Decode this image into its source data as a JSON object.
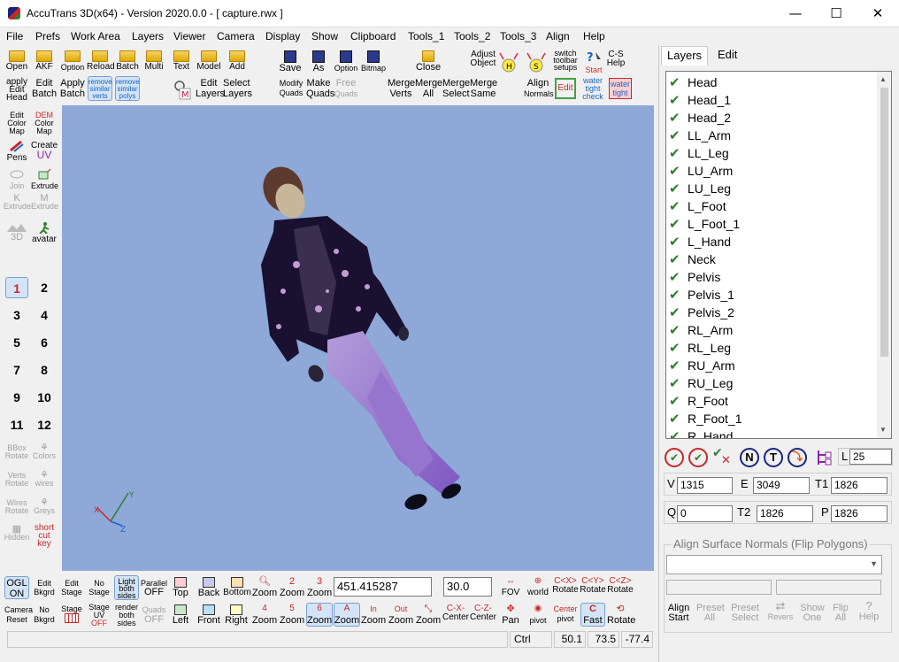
{
  "window": {
    "title": "AccuTrans 3D(x64) - Version 2020.0.0 - [ capture.rwx ]",
    "minimize_glyph": "—",
    "maximize_glyph": "☐",
    "close_glyph": "✕"
  },
  "menu": [
    "File",
    "Prefs",
    "Work Area",
    "Layers",
    "Viewer",
    "Camera",
    "Display",
    "Show",
    "Clipboard",
    "Tools_1",
    "Tools_2",
    "Tools_3",
    "Align",
    "Help"
  ],
  "toolbar_top": {
    "row1": [
      {
        "l1": "",
        "l2": "Open"
      },
      {
        "l1": "",
        "l2": "AKF"
      },
      {
        "l1": "",
        "l2": "Option"
      },
      {
        "l1": "",
        "l2": "Reload"
      },
      {
        "l1": "",
        "l2": "Batch"
      },
      {
        "l1": "",
        "l2": "Multi"
      },
      {
        "l1": "",
        "l2": "Text"
      },
      {
        "l1": "",
        "l2": "Model"
      },
      {
        "l1": "",
        "l2": "Add"
      },
      {
        "l1": "",
        "l2": "Save"
      },
      {
        "l1": "",
        "l2": "As"
      },
      {
        "l1": "",
        "l2": "Option"
      },
      {
        "l1": "",
        "l2": "Bitmap"
      },
      {
        "l1": "",
        "l2": "Close"
      },
      {
        "l1": "Adjust",
        "l2": "Object"
      },
      {
        "l1": "switch",
        "l2": "toolbar"
      },
      {
        "l1": "C-S",
        "l2": "Help"
      }
    ],
    "switch_l3": "setups",
    "start_label": "Start",
    "row2": [
      {
        "l1": "apply",
        "l2": "Edit",
        "l3": "Head"
      },
      {
        "l1": "Edit",
        "l2": "Batch"
      },
      {
        "l1": "Apply",
        "l2": "Batch"
      },
      {
        "l1": "remove",
        "l2": "similar",
        "l3": "verts"
      },
      {
        "l1": "remove",
        "l2": "similar",
        "l3": "polys"
      },
      {
        "l1": "Edit",
        "l2": "Layers"
      },
      {
        "l1": "Select",
        "l2": "Layers"
      },
      {
        "l1": "Modify",
        "l2": "Quads"
      },
      {
        "l1": "Make",
        "l2": "Quads"
      },
      {
        "l1": "Free",
        "l2": "Quads"
      },
      {
        "l1": "Merge",
        "l2": "Verts"
      },
      {
        "l1": "Merge",
        "l2": "All"
      },
      {
        "l1": "Merge",
        "l2": "Select"
      },
      {
        "l1": "Merge",
        "l2": "Same"
      },
      {
        "l1": "Align",
        "l2": "Normals"
      },
      {
        "l1": "",
        "l2": "Edit"
      },
      {
        "l1": "water",
        "l2": "tight",
        "l3": "check"
      },
      {
        "l1": "water",
        "l2": "tight"
      }
    ]
  },
  "left_panel": {
    "tools": [
      {
        "l1": "Edit",
        "l2": "Color",
        "l3": "Map"
      },
      {
        "l1": "DEM",
        "l2": "Color",
        "l3": "Map"
      },
      {
        "l1": "",
        "l2": "Pens"
      },
      {
        "l1": "Create",
        "l2": "UV"
      },
      {
        "l1": "",
        "l2": "Join"
      },
      {
        "l1": "",
        "l2": "Extrude"
      },
      {
        "l1": "K",
        "l2": "Extrude"
      },
      {
        "l1": "M",
        "l2": "Extrude"
      },
      {
        "l1": "",
        "l2": "3D"
      },
      {
        "l1": "",
        "l2": "avatar"
      }
    ],
    "numbers": [
      "1",
      "2",
      "3",
      "4",
      "5",
      "6",
      "7",
      "8",
      "9",
      "10",
      "11",
      "12"
    ],
    "tools2": [
      {
        "l1": "BBox",
        "l2": "Rotate"
      },
      {
        "l1": "",
        "l2": "Colors"
      },
      {
        "l1": "Verts",
        "l2": "Rotate"
      },
      {
        "l1": "",
        "l2": "wires"
      },
      {
        "l1": "Wires",
        "l2": "Rotate"
      },
      {
        "l1": "",
        "l2": "Greys"
      },
      {
        "l1": "",
        "l2": "Hidden"
      },
      {
        "l1": "short",
        "l2": "cut",
        "l3": "key"
      }
    ]
  },
  "axes": {
    "x": "X",
    "y": "Y",
    "z": "Z"
  },
  "bottom_toolbar": {
    "row1": [
      {
        "l1": "OGL",
        "l2": "ON"
      },
      {
        "l1": "Edit",
        "l2": "Bkgrd"
      },
      {
        "l1": "Edit",
        "l2": "Stage"
      },
      {
        "l1": "No",
        "l2": "Stage"
      },
      {
        "l1": "Light",
        "l2": "both",
        "l3": "sides"
      },
      {
        "l1": "Parallel",
        "l2": "OFF"
      },
      {
        "l1": "",
        "l2": "Top"
      },
      {
        "l1": "",
        "l2": "Back"
      },
      {
        "l1": "",
        "l2": "Bottom"
      },
      {
        "l1": "",
        "l2": "Zoom"
      },
      {
        "l1": "2",
        "l2": "Zoom"
      },
      {
        "l1": "3",
        "l2": "Zoom"
      },
      {
        "l1": "",
        "l2": "FOV"
      },
      {
        "l1": "",
        "l2": "world"
      },
      {
        "l1": "",
        "l2": "Rotate"
      },
      {
        "l1": "",
        "l2": "Rotate"
      },
      {
        "l1": "",
        "l2": "Rotate"
      }
    ],
    "row2": [
      {
        "l1": "Camera",
        "l2": "Reset"
      },
      {
        "l1": "No",
        "l2": "Bkgrd"
      },
      {
        "l1": "Stage",
        "l2": ""
      },
      {
        "l1": "Stage",
        "l2": "UV",
        "l3": "OFF"
      },
      {
        "l1": "render",
        "l2": "both",
        "l3": "sides"
      },
      {
        "l1": "Quads",
        "l2": "OFF"
      },
      {
        "l1": "",
        "l2": "Left"
      },
      {
        "l1": "",
        "l2": "Front"
      },
      {
        "l1": "",
        "l2": "Right"
      },
      {
        "l1": "4",
        "l2": "Zoom"
      },
      {
        "l1": "5",
        "l2": "Zoom"
      },
      {
        "l1": "6",
        "l2": "Zoom"
      },
      {
        "l1": "A",
        "l2": "Zoom"
      },
      {
        "l1": "In",
        "l2": "Zoom"
      },
      {
        "l1": "Out",
        "l2": "Zoom"
      },
      {
        "l1": "",
        "l2": "Zoom"
      },
      {
        "l1": "",
        "l2": "Center"
      },
      {
        "l1": "",
        "l2": "Center"
      },
      {
        "l1": "",
        "l2": "Pan"
      },
      {
        "l1": "",
        "l2": "pivot"
      },
      {
        "l1": "Center",
        "l2": "pivot"
      },
      {
        "l1": "",
        "l2": "Fast"
      },
      {
        "l1": "",
        "l2": "Rotate"
      }
    ],
    "rot_labels": [
      "C<X>",
      "C<Y>",
      "C<Z>"
    ],
    "center_labels": [
      "C-X-",
      "C-Z-"
    ],
    "zoom_value": "451.415287",
    "fov_value": "30.0"
  },
  "status_bar": {
    "ctrl": "Ctrl",
    "v1": "50.1",
    "v2": "73.5",
    "v3": "-77.4"
  },
  "right_panel": {
    "tabs": [
      "Layers",
      "Edit"
    ],
    "layers": [
      "Head",
      "Head_1",
      "Head_2",
      "LL_Arm",
      "LL_Leg",
      "LU_Arm",
      "LU_Leg",
      "L_Foot",
      "L_Foot_1",
      "L_Hand",
      "Neck",
      "Pelvis",
      "Pelvis_1",
      "Pelvis_2",
      "RL_Arm",
      "RL_Leg",
      "RU_Arm",
      "RU_Leg",
      "R_Foot",
      "R_Foot_1",
      "R_Hand"
    ],
    "check_glyph": "✔",
    "circle_buttons": [
      "N",
      "T"
    ],
    "L_label": "L",
    "L_value": "25",
    "V_label": "V",
    "V_value": "1315",
    "E_label": "E",
    "E_value": "3049",
    "T1_label": "T1",
    "T1_value": "1826",
    "Q_label": "Q",
    "Q_value": "0",
    "T2_label": "T2",
    "T2_value": "1826",
    "P_label": "P",
    "P_value": "1826",
    "group_title": "Align Surface Normals (Flip Polygons)",
    "group_buttons": [
      {
        "l1": "Align",
        "l2": "Start"
      },
      {
        "l1": "Preset",
        "l2": "All"
      },
      {
        "l1": "Preset",
        "l2": "Select"
      },
      {
        "l1": "",
        "l2": "Revers"
      },
      {
        "l1": "Show",
        "l2": "One"
      },
      {
        "l1": "Flip",
        "l2": "All"
      },
      {
        "l1": "",
        "l2": "Help"
      }
    ]
  }
}
